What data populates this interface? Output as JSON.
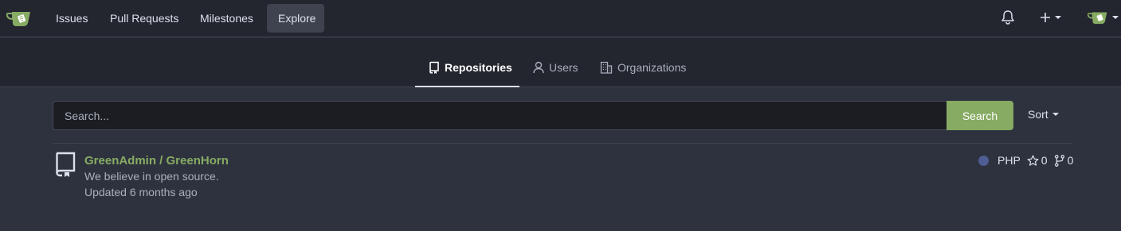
{
  "navbar": {
    "logo_icon": "gitea-teacup-logo-icon",
    "items": [
      {
        "label": "Issues"
      },
      {
        "label": "Pull Requests"
      },
      {
        "label": "Milestones"
      },
      {
        "label": "Explore",
        "active": true
      }
    ],
    "right_icons": [
      "bell-icon",
      "plus-icon",
      "avatar"
    ]
  },
  "tabs": [
    {
      "label": "Repositories",
      "icon": "repo-icon",
      "active": true
    },
    {
      "label": "Users",
      "icon": "person-icon"
    },
    {
      "label": "Organizations",
      "icon": "organization-icon"
    }
  ],
  "search": {
    "placeholder": "Search...",
    "value": "",
    "button_label": "Search"
  },
  "sort": {
    "label": "Sort"
  },
  "repos": [
    {
      "title": "GreenAdmin / GreenHorn",
      "description": "We believe in open source.",
      "updated": "Updated 6 months ago",
      "language": "PHP",
      "language_color": "#4f5d95",
      "stars": "0",
      "forks": "0"
    }
  ],
  "colors": {
    "accent_green": "#87ab63",
    "navbar_bg": "#23262f",
    "body_bg": "#2e323e"
  }
}
